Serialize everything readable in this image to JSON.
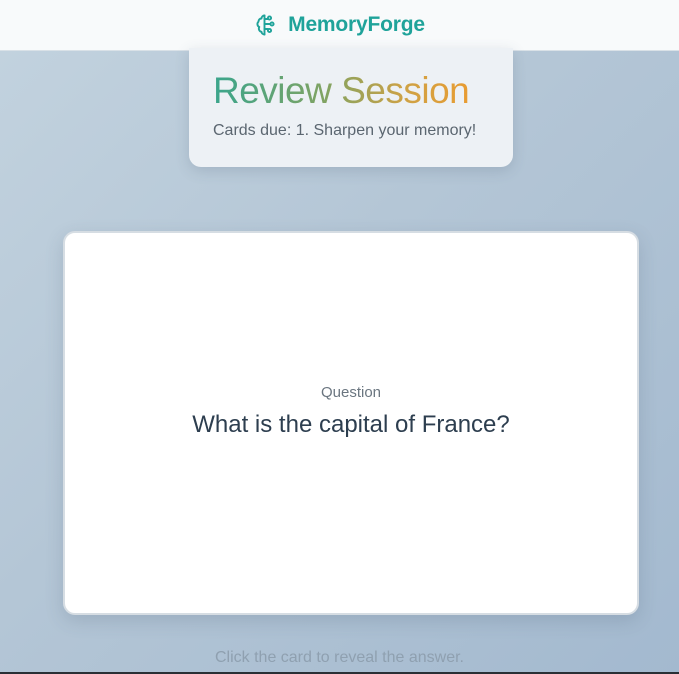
{
  "app": {
    "brand_name": "MemoryForge",
    "brand_icon": "brain-icon",
    "brand_color": "#1fa39a"
  },
  "header": {
    "title": "Review Session",
    "subtitle": "Cards due: 1. Sharpen your memory!",
    "title_gradient": [
      "#3aa58c",
      "#f09a2c"
    ]
  },
  "card": {
    "label": "Question",
    "question": "What is the capital of France?"
  },
  "hint": "Click the card to reveal the answer."
}
